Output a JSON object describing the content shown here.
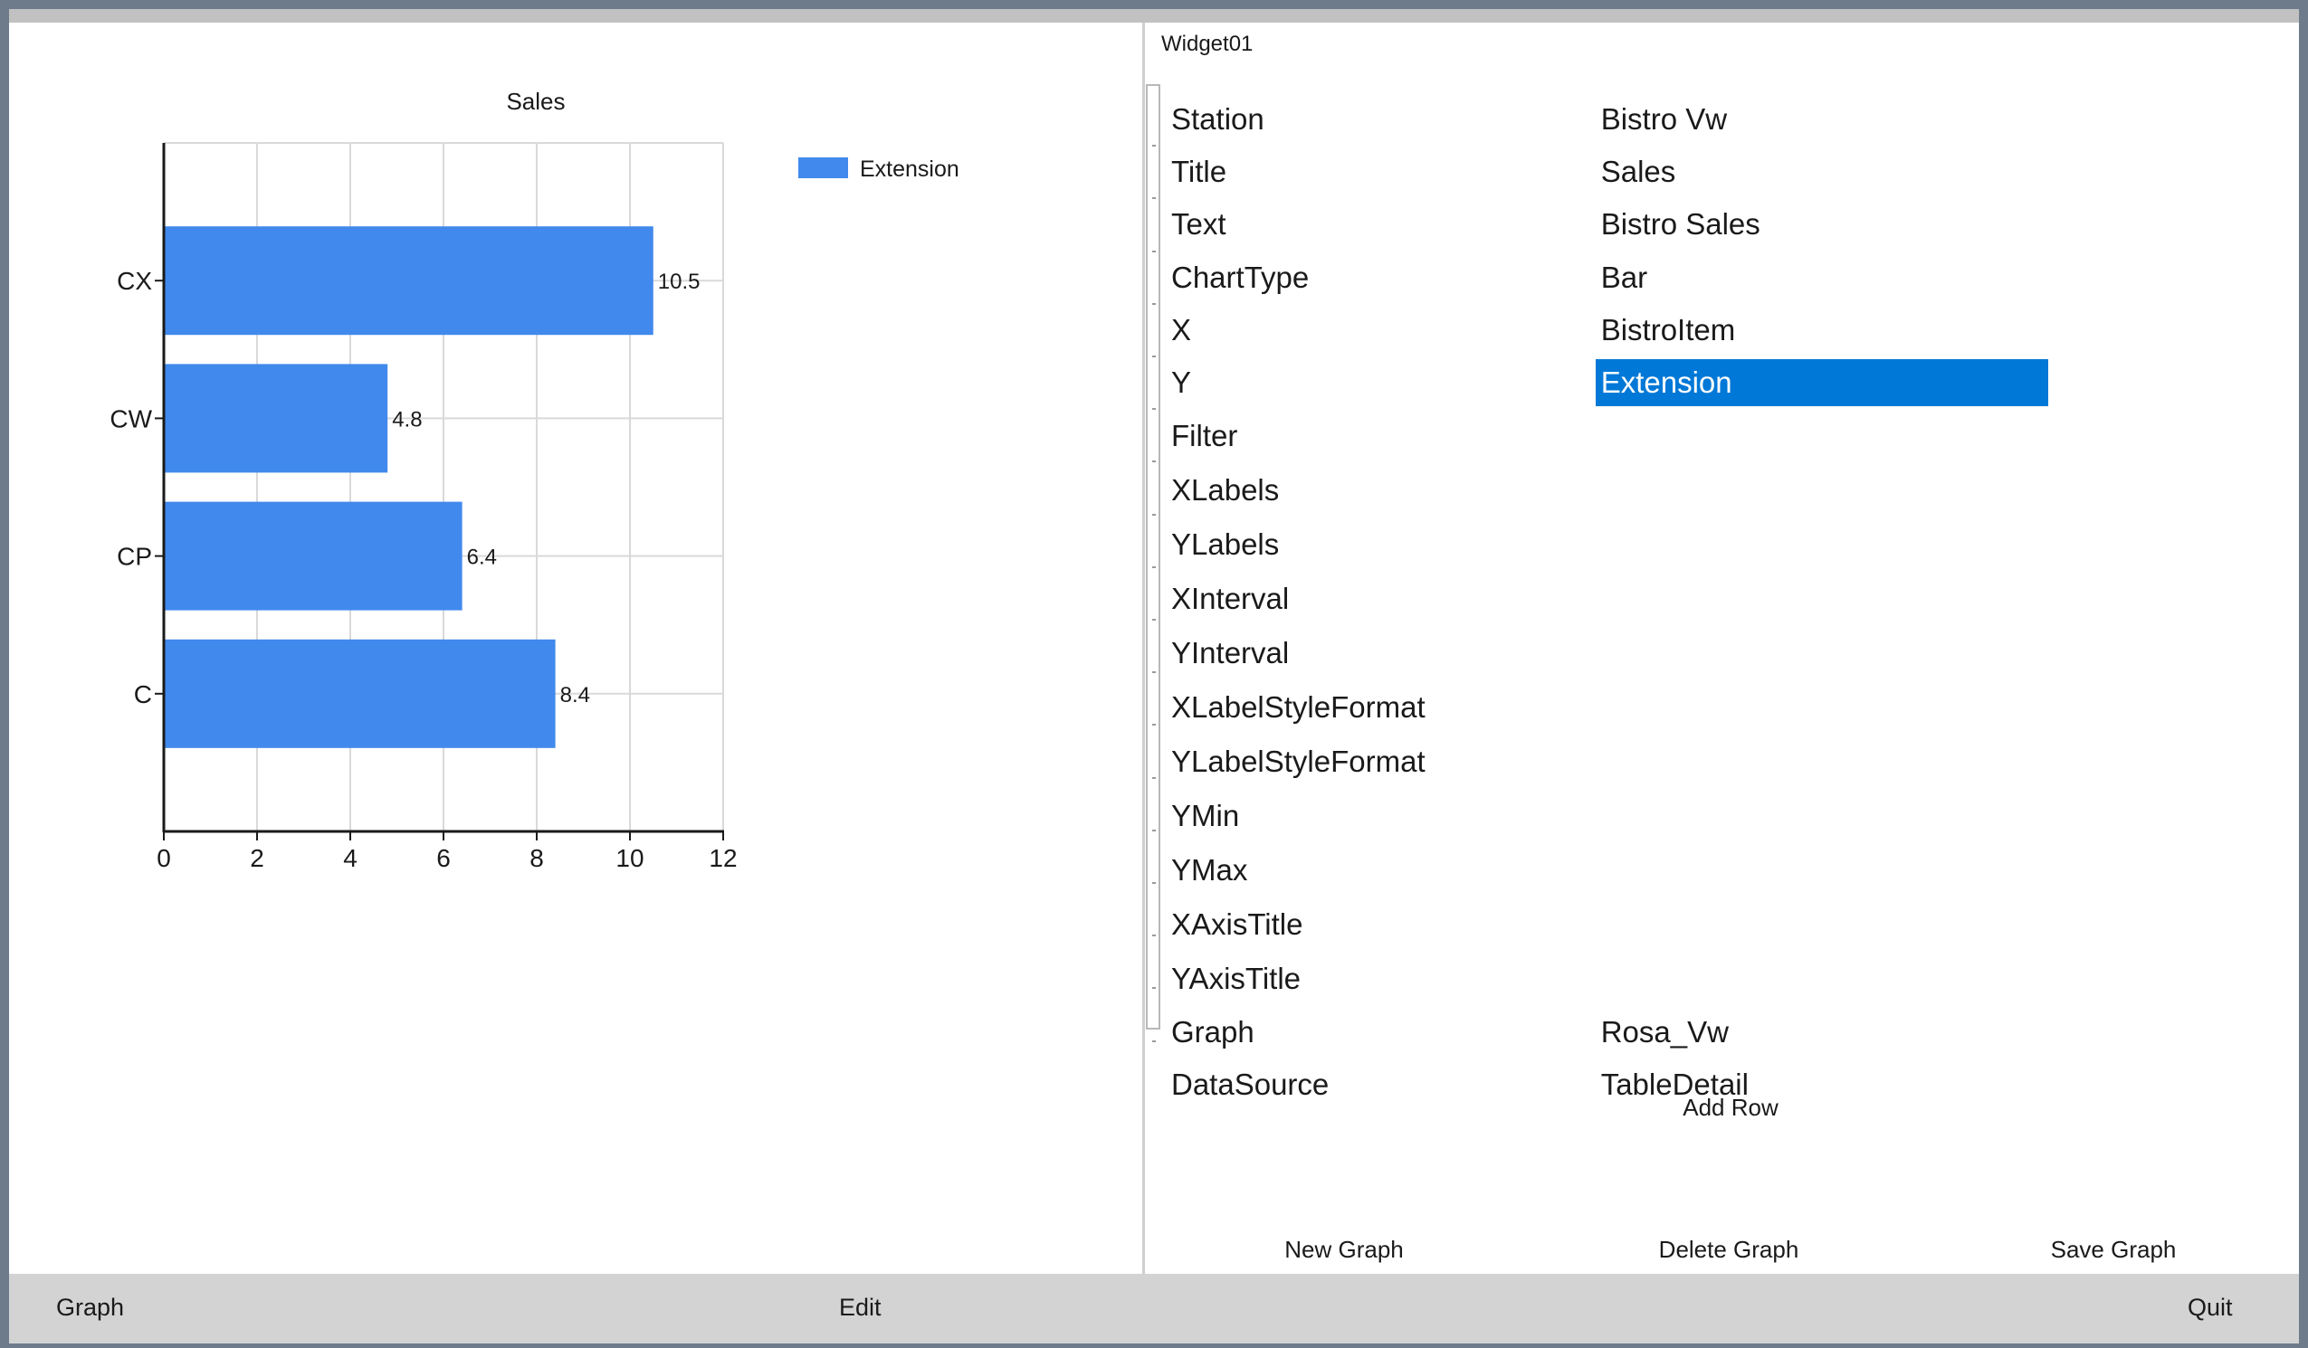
{
  "chart_data": {
    "type": "bar",
    "orientation": "horizontal",
    "title": "Sales",
    "categories": [
      "CX",
      "CW",
      "CP",
      "C"
    ],
    "series": [
      {
        "name": "Extension",
        "color": "#4189ec",
        "values": [
          10.5,
          4.8,
          6.4,
          8.4
        ]
      }
    ],
    "data_labels": [
      "10.5",
      "4.8",
      "6.4",
      "8.4"
    ],
    "xlabel": "",
    "ylabel": "",
    "xlim": [
      0,
      12
    ],
    "xticks": [
      0,
      2,
      4,
      6,
      8,
      10,
      12
    ],
    "tick_labels": [
      "0",
      "2",
      "4",
      "6",
      "8",
      "10",
      "12"
    ],
    "grid": true,
    "legend": {
      "position": "top-right",
      "entries": [
        "Extension"
      ]
    }
  },
  "props": {
    "widget_name": "Widget01",
    "selected_color": "#0078d7",
    "rows": [
      {
        "name": "Station",
        "value": "Bistro Vw"
      },
      {
        "name": "Title",
        "value": "Sales"
      },
      {
        "name": "Text",
        "value": "Bistro Sales"
      },
      {
        "name": "ChartType",
        "value": "Bar"
      },
      {
        "name": "X",
        "value": "BistroItem"
      },
      {
        "name": "Y",
        "value": "Extension",
        "selected": true
      },
      {
        "name": "Filter",
        "value": ""
      },
      {
        "name": "XLabels",
        "value": ""
      },
      {
        "name": "YLabels",
        "value": ""
      },
      {
        "name": "XInterval",
        "value": ""
      },
      {
        "name": "YInterval",
        "value": ""
      },
      {
        "name": "XLabelStyleFormat",
        "value": ""
      },
      {
        "name": "YLabelStyleFormat",
        "value": ""
      },
      {
        "name": "YMin",
        "value": ""
      },
      {
        "name": "YMax",
        "value": ""
      },
      {
        "name": "XAxisTitle",
        "value": ""
      },
      {
        "name": "YAxisTitle",
        "value": ""
      },
      {
        "name": "Graph",
        "value": "Rosa_Vw"
      },
      {
        "name": "DataSource",
        "value": "TableDetail"
      }
    ],
    "add_row_label": "Add Row",
    "new_graph_label": "New Graph",
    "delete_graph_label": "Delete Graph",
    "save_graph_label": "Save Graph"
  },
  "footer": {
    "graph_label": "Graph",
    "edit_label": "Edit",
    "quit_label": "Quit"
  }
}
